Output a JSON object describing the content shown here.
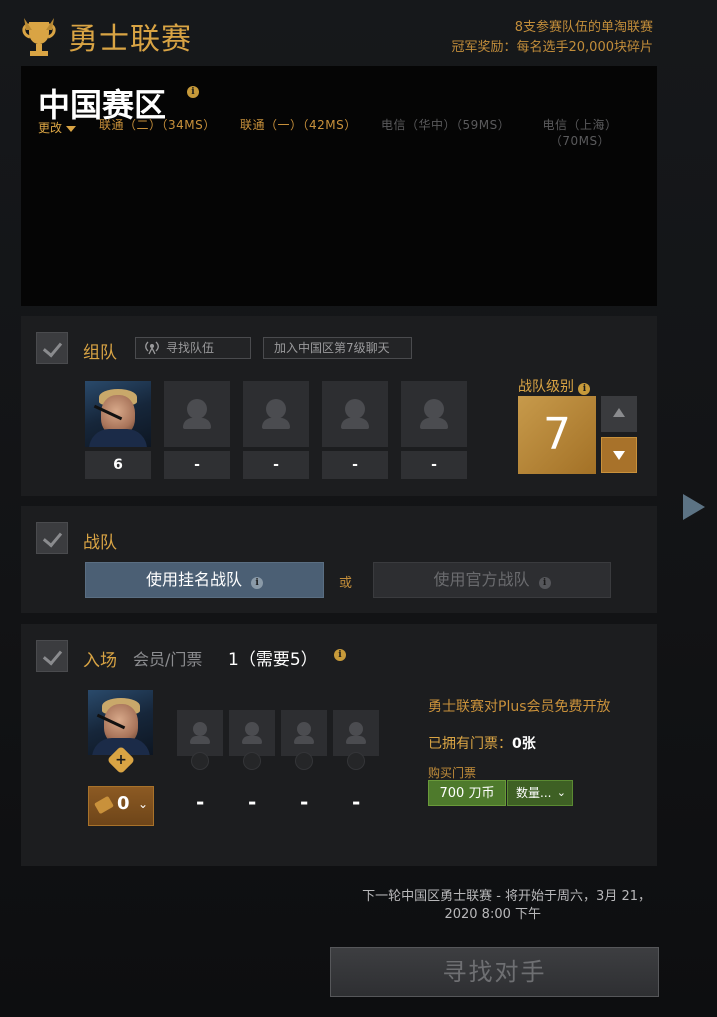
{
  "header": {
    "title": "勇士联赛",
    "info_line1": "8支参赛队伍的单淘联赛",
    "info_line2": "冠军奖励：每名选手20,000块碎片",
    "accent_color": "#d9a444"
  },
  "region": {
    "title": "中国赛区",
    "change_label": "更改",
    "servers": [
      {
        "label": "联通（二）（34MS）",
        "active": true
      },
      {
        "label": "联通（一）（42MS）",
        "active": true
      },
      {
        "label": "电信（华中）（59MS）",
        "active": false
      },
      {
        "label": "电信（上海）",
        "label2": "（70MS）",
        "active": false
      }
    ]
  },
  "party": {
    "title": "组队",
    "find_team": "寻找队伍",
    "join_chat": "加入中国区第7级聊天",
    "slots": [
      "6",
      "-",
      "-",
      "-",
      "-"
    ],
    "level_label": "战队级别",
    "level_value": "7"
  },
  "team": {
    "title": "战队",
    "use_registered": "使用挂名战队",
    "or": "或",
    "use_official": "使用官方战队"
  },
  "entry": {
    "title": "入场",
    "subtitle": "会员/门票",
    "count": "1（需要5）",
    "tickets": "0",
    "slot_dashes": [
      "-",
      "-",
      "-",
      "-"
    ],
    "plus_free": "勇士联赛对Plus会员免费开放",
    "owned_label": "已拥有门票：",
    "owned_value": "0张",
    "buy_label": "购买门票",
    "buy_price": "700 刀币",
    "buy_qty": "数量..."
  },
  "footer": {
    "next_round": "下一轮中国区勇士联赛 - 将开始于周六，3月 21，",
    "next_round2": "2020 8:00 下午",
    "find_match": "寻找对手"
  }
}
